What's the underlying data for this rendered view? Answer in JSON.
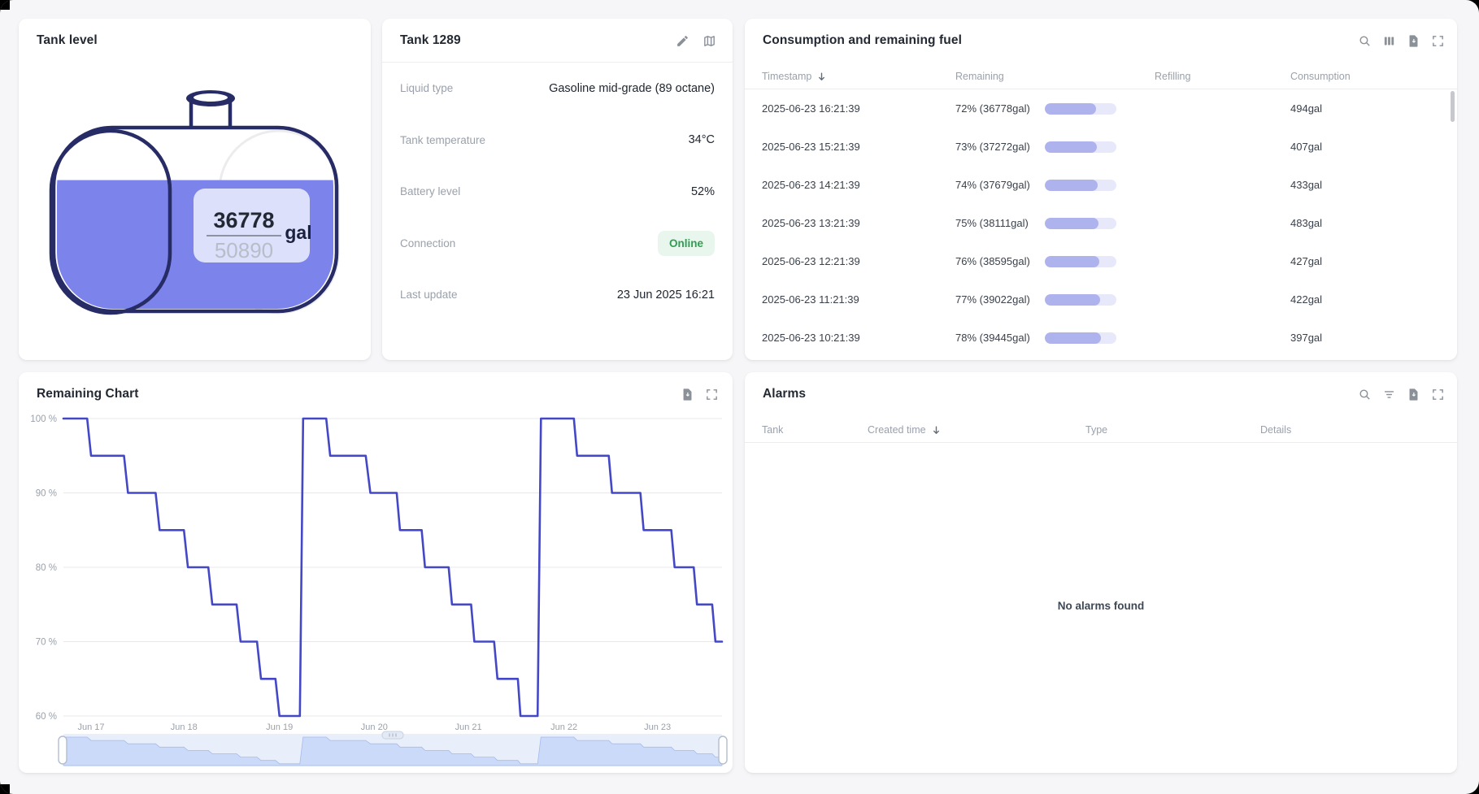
{
  "frame": {
    "bg": "#f6f6f8"
  },
  "tank_card": {
    "title": "Tank level",
    "current": "36778",
    "capacity": "50890",
    "unit": "gal",
    "fill_pct": 72,
    "liquid_color": "#7c83ea",
    "outline_color": "#272c66",
    "value_box_color": "#e1e5fb"
  },
  "details_card": {
    "title": "Tank 1289",
    "icons": [
      "edit-icon",
      "map-icon"
    ],
    "rows": [
      {
        "label": "Liquid type",
        "value": "Gasoline mid-grade (89 octane)"
      },
      {
        "label": "Tank temperature",
        "value": "34°C"
      },
      {
        "label": "Battery level",
        "value": "52%"
      },
      {
        "label": "Connection",
        "value": "Online",
        "badge": true,
        "badge_bg": "#e9f6ee",
        "badge_color": "#2f9e50"
      },
      {
        "label": "Last update",
        "value": "23 Jun 2025 16:21"
      }
    ]
  },
  "consumption_card": {
    "title": "Consumption and remaining fuel",
    "icons": [
      "search-icon",
      "columns-icon",
      "export-icon",
      "fullscreen-icon"
    ],
    "columns": [
      {
        "label": "Timestamp",
        "sorted": "desc"
      },
      {
        "label": "Remaining"
      },
      {
        "label": "Refilling"
      },
      {
        "label": "Consumption"
      }
    ],
    "bar_fill_color": "#aeb3ee",
    "bar_track_color": "#e7e9fb",
    "rows": [
      {
        "timestamp": "2025-06-23 16:21:39",
        "remaining": "72% (36778gal)",
        "remaining_pct": 72,
        "refilling": "",
        "consumption": "494gal"
      },
      {
        "timestamp": "2025-06-23 15:21:39",
        "remaining": "73% (37272gal)",
        "remaining_pct": 73,
        "refilling": "",
        "consumption": "407gal"
      },
      {
        "timestamp": "2025-06-23 14:21:39",
        "remaining": "74% (37679gal)",
        "remaining_pct": 74,
        "refilling": "",
        "consumption": "433gal"
      },
      {
        "timestamp": "2025-06-23 13:21:39",
        "remaining": "75% (38111gal)",
        "remaining_pct": 75,
        "refilling": "",
        "consumption": "483gal"
      },
      {
        "timestamp": "2025-06-23 12:21:39",
        "remaining": "76% (38595gal)",
        "remaining_pct": 76,
        "refilling": "",
        "consumption": "427gal"
      },
      {
        "timestamp": "2025-06-23 11:21:39",
        "remaining": "77% (39022gal)",
        "remaining_pct": 77,
        "refilling": "",
        "consumption": "422gal"
      },
      {
        "timestamp": "2025-06-23 10:21:39",
        "remaining": "78% (39445gal)",
        "remaining_pct": 78,
        "refilling": "",
        "consumption": "397gal"
      }
    ]
  },
  "chart_card": {
    "title": "Remaining Chart",
    "icons": [
      "export-icon",
      "fullscreen-icon"
    ],
    "chart_data": {
      "type": "line",
      "series_name": "Remaining",
      "line_color": "#4448c6",
      "grid": true,
      "legend": false,
      "ylim": [
        60,
        100
      ],
      "y_ticks": [
        {
          "value": 100,
          "label": "100 %"
        },
        {
          "value": 90,
          "label": "90 %"
        },
        {
          "value": 80,
          "label": "80 %"
        },
        {
          "value": 70,
          "label": "70 %"
        },
        {
          "value": 60,
          "label": "60 %"
        }
      ],
      "x_ticks": [
        {
          "pos": 0.042,
          "label": "Jun 17"
        },
        {
          "pos": 0.183,
          "label": "Jun 18"
        },
        {
          "pos": 0.328,
          "label": "Jun 19"
        },
        {
          "pos": 0.472,
          "label": "Jun 20"
        },
        {
          "pos": 0.615,
          "label": "Jun 21"
        },
        {
          "pos": 0.76,
          "label": "Jun 22"
        },
        {
          "pos": 0.902,
          "label": "Jun 23"
        }
      ],
      "points": [
        [
          0.0,
          100
        ],
        [
          0.036,
          100
        ],
        [
          0.042,
          95
        ],
        [
          0.092,
          95
        ],
        [
          0.098,
          90
        ],
        [
          0.14,
          90
        ],
        [
          0.146,
          85
        ],
        [
          0.183,
          85
        ],
        [
          0.189,
          80
        ],
        [
          0.22,
          80
        ],
        [
          0.226,
          75
        ],
        [
          0.263,
          75
        ],
        [
          0.269,
          70
        ],
        [
          0.294,
          70
        ],
        [
          0.3,
          65
        ],
        [
          0.322,
          65
        ],
        [
          0.328,
          60
        ],
        [
          0.359,
          60
        ],
        [
          0.364,
          100
        ],
        [
          0.399,
          100
        ],
        [
          0.405,
          95
        ],
        [
          0.459,
          95
        ],
        [
          0.466,
          90
        ],
        [
          0.506,
          90
        ],
        [
          0.511,
          85
        ],
        [
          0.544,
          85
        ],
        [
          0.549,
          80
        ],
        [
          0.585,
          80
        ],
        [
          0.59,
          75
        ],
        [
          0.619,
          75
        ],
        [
          0.624,
          70
        ],
        [
          0.654,
          70
        ],
        [
          0.659,
          65
        ],
        [
          0.69,
          65
        ],
        [
          0.694,
          60
        ],
        [
          0.72,
          60
        ],
        [
          0.725,
          100
        ],
        [
          0.775,
          100
        ],
        [
          0.78,
          95
        ],
        [
          0.828,
          95
        ],
        [
          0.833,
          90
        ],
        [
          0.876,
          90
        ],
        [
          0.881,
          85
        ],
        [
          0.923,
          85
        ],
        [
          0.928,
          80
        ],
        [
          0.957,
          80
        ],
        [
          0.962,
          75
        ],
        [
          0.985,
          75
        ],
        [
          0.99,
          70
        ],
        [
          1.0,
          70
        ]
      ],
      "brush": {
        "track_color": "#e9eefb",
        "area_color": "#cbdaf8",
        "edge_color": "#a3bbed"
      }
    }
  },
  "alarms_card": {
    "title": "Alarms",
    "icons": [
      "search-icon",
      "filter-icon",
      "export-icon",
      "fullscreen-icon"
    ],
    "columns": [
      {
        "label": "Tank"
      },
      {
        "label": "Created time",
        "sorted": "desc"
      },
      {
        "label": "Type"
      },
      {
        "label": "Details"
      }
    ],
    "empty_message": "No alarms found"
  }
}
